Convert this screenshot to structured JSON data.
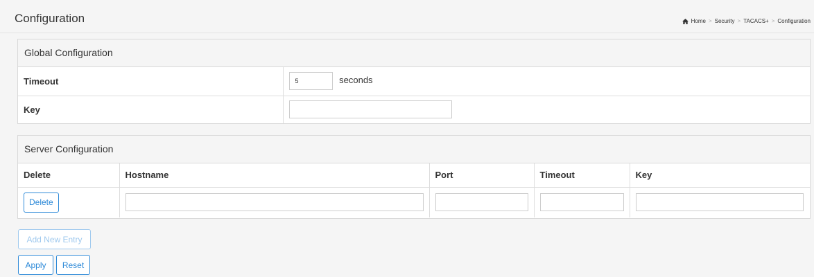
{
  "header": {
    "title": "Configuration",
    "breadcrumb": [
      "Home",
      "Security",
      "TACACS+",
      "Configuration"
    ],
    "breadcrumb_separator": ">"
  },
  "global_config": {
    "heading": "Global Configuration",
    "timeout_label": "Timeout",
    "timeout_value": "5",
    "timeout_unit": "seconds",
    "key_label": "Key",
    "key_value": ""
  },
  "server_config": {
    "heading": "Server Configuration",
    "columns": [
      "Delete",
      "Hostname",
      "Port",
      "Timeout",
      "Key"
    ],
    "rows": [
      {
        "delete_label": "Delete",
        "hostname": "",
        "port": "",
        "timeout": "",
        "key": ""
      }
    ]
  },
  "buttons": {
    "add_new_entry": "Add New Entry",
    "apply": "Apply",
    "reset": "Reset"
  },
  "colors": {
    "accent": "#2e8ad8",
    "disabled": "#9fc9ee",
    "background": "#f5f5f5"
  }
}
